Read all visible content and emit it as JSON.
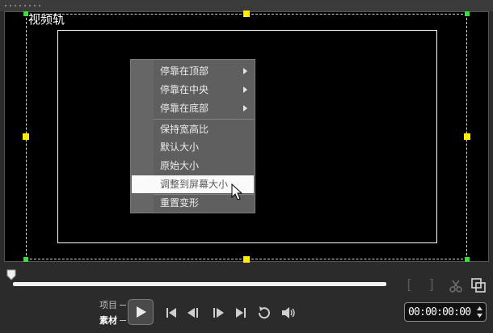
{
  "preview": {
    "track_label": "视频轨"
  },
  "context_menu": {
    "items": [
      {
        "label": "停靠在顶部",
        "has_submenu": true
      },
      {
        "label": "停靠在中央",
        "has_submenu": true
      },
      {
        "label": "停靠在底部",
        "has_submenu": true
      },
      {
        "label": "保持宽高比",
        "has_submenu": false
      },
      {
        "label": "默认大小",
        "has_submenu": false
      },
      {
        "label": "原始大小",
        "has_submenu": false
      },
      {
        "label": "调整到屏幕大小",
        "has_submenu": false,
        "highlighted": true
      },
      {
        "label": "重置变形",
        "has_submenu": false
      }
    ]
  },
  "playback": {
    "mode_project": "项目",
    "mode_clip": "素材",
    "active_mode": "素材",
    "mark_in": "[",
    "mark_out": "]",
    "timecode": "00:00:00:00",
    "scrub_position": 0
  },
  "colors": {
    "handle": "#ffee00",
    "corner_handle": "#39e03c",
    "menu_bg": "#5f5f5f",
    "highlight_bg": "#fafafa"
  }
}
